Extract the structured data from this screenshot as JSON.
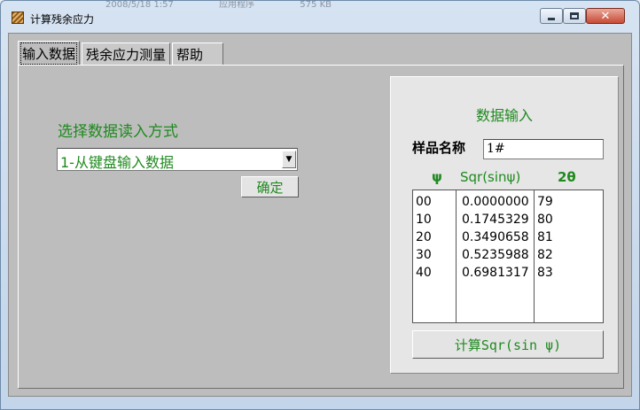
{
  "window": {
    "title": "计算残余应力",
    "background_text": [
      "2008/5/18 1:57",
      "应用程序",
      "575 KB"
    ],
    "close_glyph": "✕"
  },
  "tabs": [
    {
      "label": "输入数据",
      "active": true
    },
    {
      "label": "残余应力测量",
      "active": false
    },
    {
      "label": "帮助",
      "active": false
    }
  ],
  "input_method": {
    "label": "选择数据读入方式",
    "selected": "1-从键盘输入数据",
    "ok_label": "确定"
  },
  "data_panel": {
    "title": "数据输入",
    "sample_name_label": "样品名称",
    "sample_name_value": "1#",
    "columns": {
      "psi": "ψ",
      "sqr": "Sqr(sinψ)",
      "two_theta": "2θ"
    },
    "psi_values": [
      "00",
      "10",
      "20",
      "30",
      "40"
    ],
    "sqr_values": [
      "0.0000000",
      "0.1745329",
      "0.3490658",
      "0.5235988",
      "0.6981317"
    ],
    "two_theta_values": [
      "79",
      "80",
      "81",
      "82",
      "83"
    ],
    "calc_label": "计算Sqr(sin ψ)"
  },
  "colors": {
    "accent_green": "#1f8a1f",
    "client_gray": "#bdbdbd",
    "panel_gray": "#e6e6e6"
  }
}
